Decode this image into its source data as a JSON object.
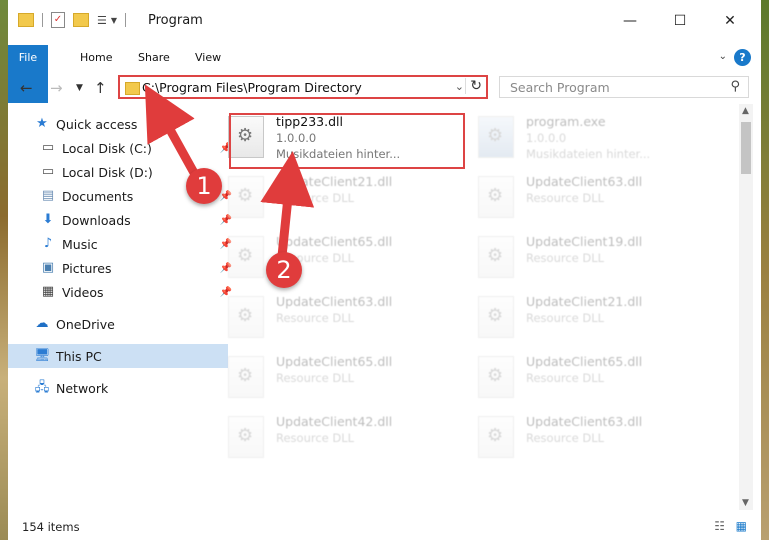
{
  "window": {
    "title": "Program",
    "minimize": "—",
    "maximize": "☐",
    "close": "✕"
  },
  "ribbon": {
    "tabs": [
      "File",
      "Home",
      "Share",
      "View"
    ],
    "help": "?"
  },
  "nav": {
    "address": "C:\\Program Files\\Program Directory",
    "search_placeholder": "Search Program"
  },
  "sidebar": {
    "items": [
      {
        "label": "Quick access",
        "icon": "star-icon",
        "pinned": false
      },
      {
        "label": "Local Disk (C:)",
        "icon": "drive-icon",
        "pinned": true
      },
      {
        "label": "Local Disk (D:)",
        "icon": "drive-icon",
        "pinned": false
      },
      {
        "label": "Documents",
        "icon": "documents-icon",
        "pinned": true
      },
      {
        "label": "Downloads",
        "icon": "download-icon",
        "pinned": true
      },
      {
        "label": "Music",
        "icon": "music-icon",
        "pinned": true
      },
      {
        "label": "Pictures",
        "icon": "pictures-icon",
        "pinned": true
      },
      {
        "label": "Videos",
        "icon": "videos-icon",
        "pinned": true
      },
      {
        "label": "OneDrive",
        "icon": "cloud-icon",
        "pinned": false
      },
      {
        "label": "This PC",
        "icon": "computer-icon",
        "pinned": false,
        "selected": true
      },
      {
        "label": "Network",
        "icon": "network-icon",
        "pinned": false
      }
    ]
  },
  "files": [
    {
      "name": "tipp233.dll",
      "line2": "1.0.0.0",
      "line3": "Musikdateien hinter...",
      "highlighted": true
    },
    {
      "name": "program.exe",
      "line2": "1.0.0.0",
      "line3": "Musikdateien hinter..."
    },
    {
      "name": "UpdateClient21.dll",
      "line2": "Resource DLL"
    },
    {
      "name": "UpdateClient63.dll",
      "line2": "Resource DLL"
    },
    {
      "name": "UpdateClient65.dll",
      "line2": "Resource DLL"
    },
    {
      "name": "UpdateClient19.dll",
      "line2": "Resource DLL"
    },
    {
      "name": "UpdateClient63.dll",
      "line2": "Resource DLL"
    },
    {
      "name": "UpdateClient21.dll",
      "line2": "Resource DLL"
    },
    {
      "name": "UpdateClient65.dll",
      "line2": "Resource DLL"
    },
    {
      "name": "UpdateClient65.dll",
      "line2": "Resource DLL"
    },
    {
      "name": "UpdateClient42.dll",
      "line2": "Resource DLL"
    },
    {
      "name": "UpdateClient63.dll",
      "line2": "Resource DLL"
    }
  ],
  "status": {
    "count": "154 items"
  },
  "annotations": {
    "step1": "1",
    "step2": "2"
  },
  "colors": {
    "accent": "#1979ca",
    "highlight": "#dd4444",
    "selected": "#cce0f4"
  }
}
